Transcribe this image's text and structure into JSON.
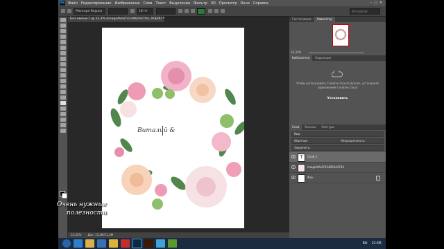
{
  "app": {
    "menu": [
      "Файл",
      "Редактирование",
      "Изображение",
      "Слои",
      "Текст",
      "Выделение",
      "Фильтр",
      "3D",
      "Просмотр",
      "Окно",
      "Справка"
    ],
    "logo": "Ps"
  },
  "options_bar": {
    "font": "Маскара Regular",
    "size": "18 пт",
    "search": "Интерфейс"
  },
  "document": {
    "tab_title": "Без имени-1 @ 33,3% (imageAVo4742496244704, RGB/8) *",
    "zoom_status": "33,33%",
    "doc_info": "Док: 11,4M/11,4M",
    "canvas_text": "Виталий &"
  },
  "panels": {
    "navigator_tabs": [
      "Гистограмма",
      "Навигатор"
    ],
    "navigator_zoom": "33,33%",
    "library_tabs": [
      "Библиотеки",
      "Коррекция"
    ],
    "cc_message": "Чтобы использовать Creative Cloud Libraries, установите приложение Creative Cloud",
    "cc_install": "Установить",
    "layers_tabs": [
      "Слои",
      "Каналы",
      "Контуры"
    ],
    "layers_filter": "Вид",
    "blend_mode": "Обычные",
    "opacity": "Непрозрачность:",
    "fill_label": "Закрепить:",
    "layers": [
      {
        "name": "Слой 1",
        "thumb": "T",
        "selected": true
      },
      {
        "name": "imageAVo4742496244704",
        "thumb": "",
        "selected": false
      },
      {
        "name": "Фон",
        "thumb": "",
        "selected": false,
        "locked": true
      }
    ]
  },
  "taskbar": {
    "time": "21:05",
    "tray_lang": "RU"
  },
  "watermark": {
    "line1": "Очень нужные",
    "line2": "полезности"
  },
  "colors": {
    "ps_bg": "#282828",
    "panel": "#535353",
    "accent_ps": "#31a8ff",
    "swatch_green": "#2a7a3a",
    "taskbar": "#1c2c40"
  }
}
